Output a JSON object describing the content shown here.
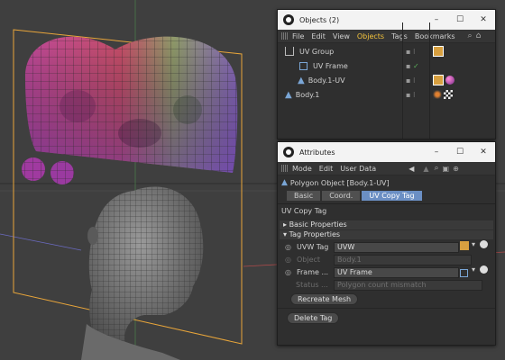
{
  "objects_window": {
    "title": "Objects (2)",
    "controls": {
      "minimize": "–",
      "maximize": "☐",
      "close": "✕"
    },
    "menu": [
      "File",
      "Edit",
      "View",
      "Objects",
      "Tags",
      "Bookmarks"
    ],
    "rows": [
      {
        "name": "UV Group"
      },
      {
        "name": "UV Frame"
      },
      {
        "name": "Body.1-UV"
      },
      {
        "name": "Body.1"
      }
    ]
  },
  "attributes_window": {
    "title": "Attributes",
    "controls": {
      "minimize": "–",
      "maximize": "☐",
      "close": "✕"
    },
    "menu": [
      "Mode",
      "Edit",
      "User Data"
    ],
    "object_line": "Polygon Object [Body.1-UV]",
    "tabs": [
      "Basic",
      "Coord.",
      "UV Copy Tag"
    ],
    "active_tab": "UV Copy Tag",
    "tag_title": "UV Copy Tag",
    "basic_properties": "Basic Properties",
    "tag_properties": "Tag Properties",
    "fields": [
      {
        "label": "UVW Tag",
        "value": "UVW"
      },
      {
        "label": "Object",
        "value": "Body.1"
      },
      {
        "label": "Frame ...",
        "value": "UV Frame"
      },
      {
        "label": "Status ...",
        "value": "Polygon count mismatch"
      }
    ],
    "recreate_button": "Recreate Mesh",
    "delete_button": "Delete Tag"
  },
  "colors": {
    "accent": "#f2c23c",
    "tab_active": "#6b8fc4",
    "panel": "#2f2f2f",
    "viewport": "#3f3f3f",
    "frame": "#e8a53a"
  }
}
